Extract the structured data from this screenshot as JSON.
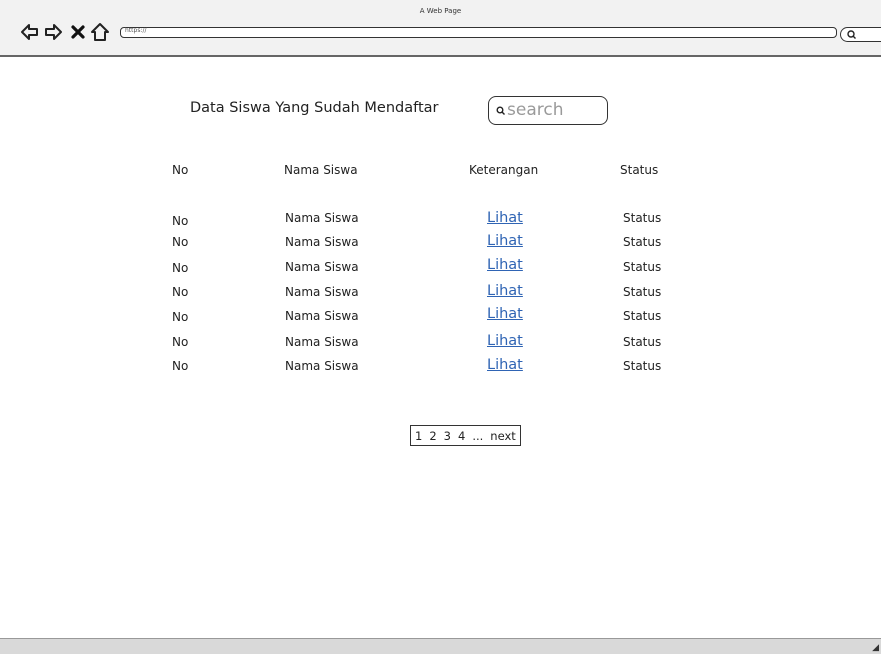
{
  "browser": {
    "window_title": "A Web Page",
    "url": "https://"
  },
  "page": {
    "title": "Data Siswa Yang Sudah Mendaftar",
    "search_placeholder": "search"
  },
  "table": {
    "headers": [
      "No",
      "Nama Siswa",
      "Keterangan",
      "Status"
    ],
    "rows": [
      {
        "no": "No",
        "nama": "Nama Siswa",
        "keterangan": "Lihat",
        "status": "Status"
      },
      {
        "no": "No",
        "nama": "Nama Siswa",
        "keterangan": "Lihat",
        "status": "Status"
      },
      {
        "no": "No",
        "nama": "Nama Siswa",
        "keterangan": "Lihat",
        "status": "Status"
      },
      {
        "no": "No",
        "nama": "Nama Siswa",
        "keterangan": "Lihat",
        "status": "Status"
      },
      {
        "no": "No",
        "nama": "Nama Siswa",
        "keterangan": "Lihat",
        "status": "Status"
      },
      {
        "no": "No",
        "nama": "Nama Siswa",
        "keterangan": "Lihat",
        "status": "Status"
      },
      {
        "no": "No",
        "nama": "Nama Siswa",
        "keterangan": "Lihat",
        "status": "Status"
      }
    ]
  },
  "pagination": {
    "pages": [
      "1",
      "2",
      "3",
      "4"
    ],
    "ellipsis": "...",
    "next": "next"
  },
  "icons": {
    "back": "back-arrow-icon",
    "forward": "forward-arrow-icon",
    "stop": "close-icon",
    "home": "home-icon",
    "search": "search-icon"
  },
  "colors": {
    "link": "#2f64b4",
    "placeholder": "#9a9a9a"
  }
}
